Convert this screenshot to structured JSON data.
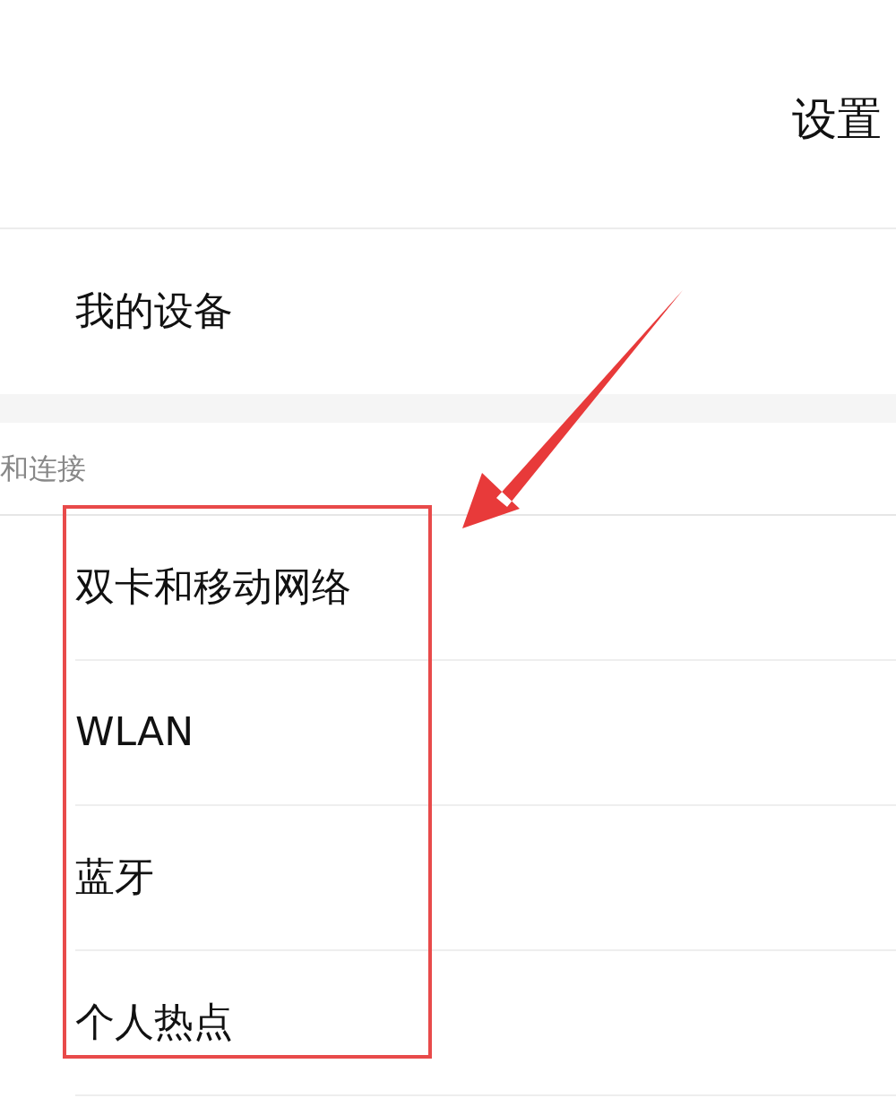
{
  "header": {
    "title": "设置"
  },
  "top_item": {
    "label": "我的设备"
  },
  "section": {
    "title": "和连接",
    "items": [
      {
        "label": "双卡和移动网络"
      },
      {
        "label": "WLAN"
      },
      {
        "label": "蓝牙"
      },
      {
        "label": "个人热点"
      }
    ]
  }
}
